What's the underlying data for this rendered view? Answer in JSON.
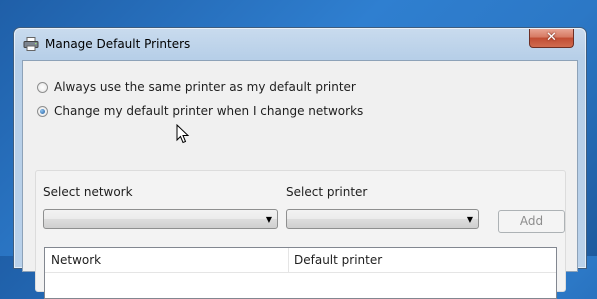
{
  "window": {
    "title": "Manage Default Printers",
    "close_label": "✕"
  },
  "options": [
    {
      "label": "Always use the same printer as my default printer",
      "checked": false
    },
    {
      "label": "Change my default printer when I change networks",
      "checked": true
    }
  ],
  "form": {
    "network_label": "Select network",
    "network_value": "",
    "printer_label": "Select printer",
    "printer_value": "",
    "add_label": "Add"
  },
  "table": {
    "columns": [
      "Network",
      "Default printer"
    ],
    "rows": []
  }
}
